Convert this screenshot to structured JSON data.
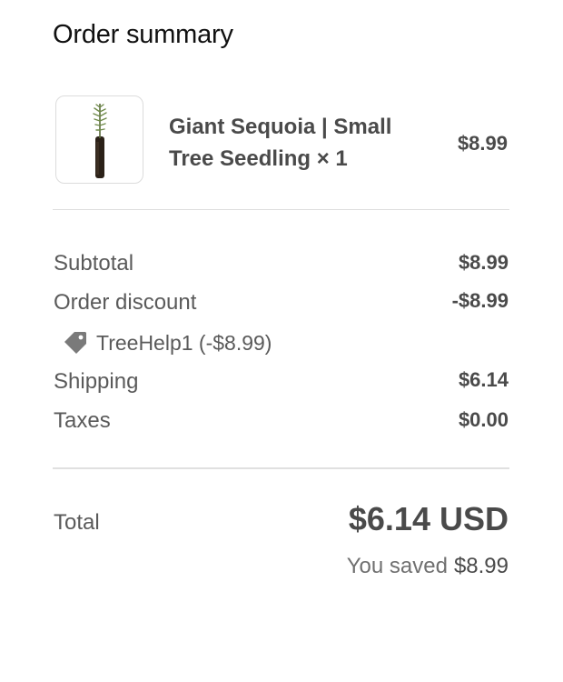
{
  "heading": "Order summary",
  "product": {
    "image_icon": "tree-seedling-image",
    "name": "Giant Sequoia | Small Tree Seedling × 1",
    "price": "$8.99"
  },
  "summary": {
    "subtotal_label": "Subtotal",
    "subtotal_value": "$8.99",
    "discount_label": "Order discount",
    "discount_value": "-$8.99",
    "discount_code": "TreeHelp1 (-$8.99)",
    "discount_icon": "tag-icon",
    "shipping_label": "Shipping",
    "shipping_value": "$6.14",
    "taxes_label": "Taxes",
    "taxes_value": "$0.00"
  },
  "total": {
    "label": "Total",
    "value": "$6.14 USD",
    "saved_text": "You saved",
    "saved_amount": "$8.99"
  },
  "colors": {
    "text_dark": "#4a4a4a",
    "text_muted": "#5a5a5a",
    "divider": "#dddddd",
    "tag_icon": "#7a7a7a"
  }
}
